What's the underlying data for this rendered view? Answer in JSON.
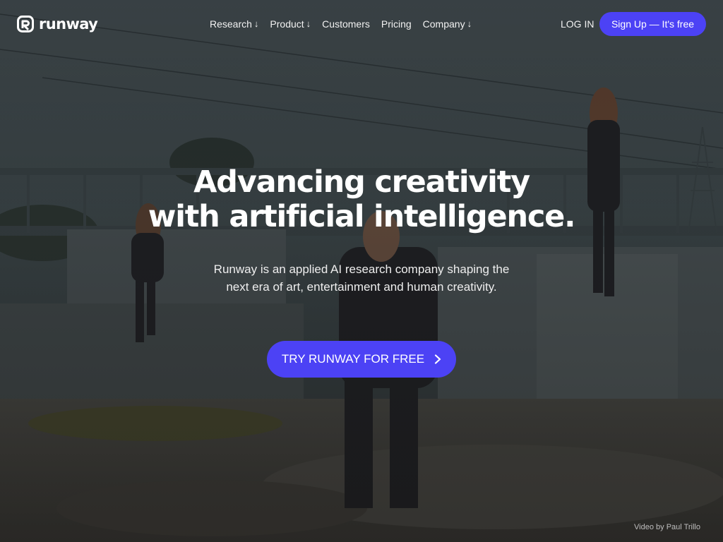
{
  "brand": {
    "name": "runway"
  },
  "nav": {
    "items": [
      {
        "label": "Research",
        "dropdown": true
      },
      {
        "label": "Product",
        "dropdown": true
      },
      {
        "label": "Customers",
        "dropdown": false
      },
      {
        "label": "Pricing",
        "dropdown": false
      },
      {
        "label": "Company",
        "dropdown": true
      }
    ],
    "dropdown_glyph": "↓",
    "login_label": "LOG IN",
    "signup_label": "Sign Up — It's free"
  },
  "hero": {
    "headline_line1": "Advancing creativity",
    "headline_line2": "with artificial intelligence.",
    "subtext_line1": "Runway is an applied AI research company shaping the",
    "subtext_line2": "next era of art, entertainment and human creativity.",
    "cta_label": "TRY RUNWAY FOR FREE",
    "video_credit": "Video by Paul Trillo"
  },
  "colors": {
    "accent": "#4c42f5",
    "text": "#ffffff"
  },
  "icons": {
    "logo": "runway-logo-icon",
    "cta": "chevron-right-icon"
  }
}
